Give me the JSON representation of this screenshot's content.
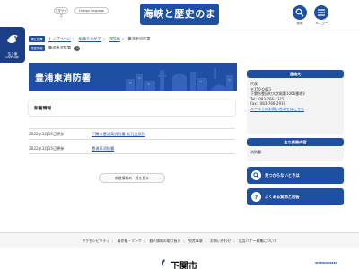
{
  "header": {
    "text_size_btn": "文字サイズ",
    "language_btn": "Foreign language",
    "logo_text": "海峡と歴史のまち下関",
    "search_label": "検索",
    "menu_label": "メニュー"
  },
  "side_badge": {
    "label_line1": "住き楽",
    "label_line2": "Livesup!"
  },
  "breadcrumb": {
    "chip": "現在位置",
    "items": [
      "トップページ",
      "組織でさがす",
      "消防局",
      "豊浦東消防署"
    ],
    "chip2": "関連情報",
    "current": "豊浦東消防署"
  },
  "hero": {
    "title": "豊浦東消防署"
  },
  "news": {
    "heading": "新着情報",
    "rows": [
      {
        "date": "2022年3月15日更新",
        "link": "下関市豊浦東消防署 新刊出張所"
      },
      {
        "date": "2022年3月15日更新",
        "link": "豊浦東消防署"
      }
    ],
    "more_label": "新着情報の一覧を見る"
  },
  "contact": {
    "heading": "連絡先",
    "lines": [
      "代表",
      "〒750-0421",
      "下関市豊田町大字殿敷1066番地3",
      "Tel：083-766-1315",
      "Fax：083-766-2919"
    ],
    "mail_link": "メールでのお問い合わせはこちら"
  },
  "business": {
    "heading": "主な業務内容",
    "text": "消防署"
  },
  "buttons": {
    "search_help": "見つからないときは",
    "faq": "よくある質問と回答"
  },
  "footer": {
    "links": [
      "アクセシビリティ",
      "著作権・リンク",
      "個人情報の取り扱い",
      "免責事項",
      "お問い合わせ",
      "広告バナー募集について"
    ],
    "city": "下関市",
    "brand_right": "SHIMONOSEKI"
  },
  "colors": {
    "primary": "#1e4fa0"
  }
}
